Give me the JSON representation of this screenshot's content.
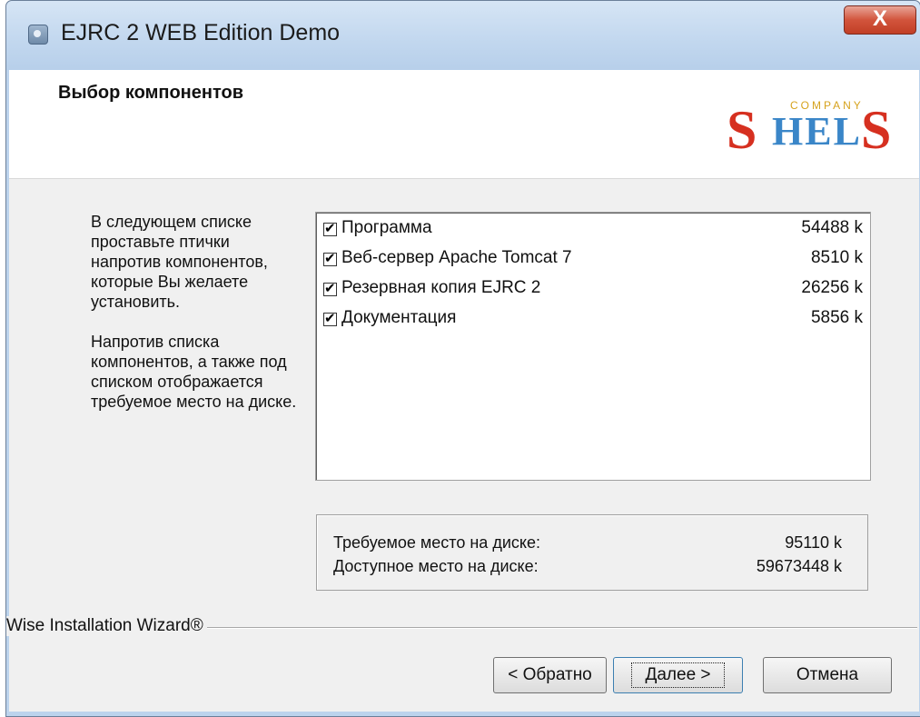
{
  "window": {
    "title": "EJRC 2 WEB Edition Demo",
    "close_label": "X"
  },
  "header": {
    "title": "Выбор компонентов",
    "logo_company": "COMPANY",
    "logo_s_left": "S",
    "logo_mid": "HEL",
    "logo_s_right": "S"
  },
  "description": {
    "para1": "В следующем списке проставьте птички напротив компонентов, которые Вы желаете установить.",
    "para2": "Напротив списка компонентов, а также под списком отображается требуемое место на диске."
  },
  "components": [
    {
      "name": "Программа",
      "size": "54488 k",
      "checked": true
    },
    {
      "name": "Веб-сервер Apache Tomcat 7",
      "size": "8510 k",
      "checked": true
    },
    {
      "name": "Резервная копия EJRC 2",
      "size": "26256 k",
      "checked": true
    },
    {
      "name": "Документация",
      "size": "5856 k",
      "checked": true
    }
  ],
  "disk": {
    "required_label": "Требуемое место на диске:",
    "required_value": "95110 k",
    "available_label": "Доступное место на диске:",
    "available_value": "59673448 k"
  },
  "wizard_label": "Wise Installation Wizard®",
  "buttons": {
    "back": "< Обратно",
    "next": "Далее >",
    "cancel": "Отмена"
  },
  "colors": {
    "logo_red": "#d63020",
    "logo_blue": "#3a86c8",
    "logo_gold": "#d6a21c"
  },
  "icons": {
    "app": "installer-icon",
    "close": "close-icon",
    "checkbox": "checkbox-checked-icon"
  }
}
